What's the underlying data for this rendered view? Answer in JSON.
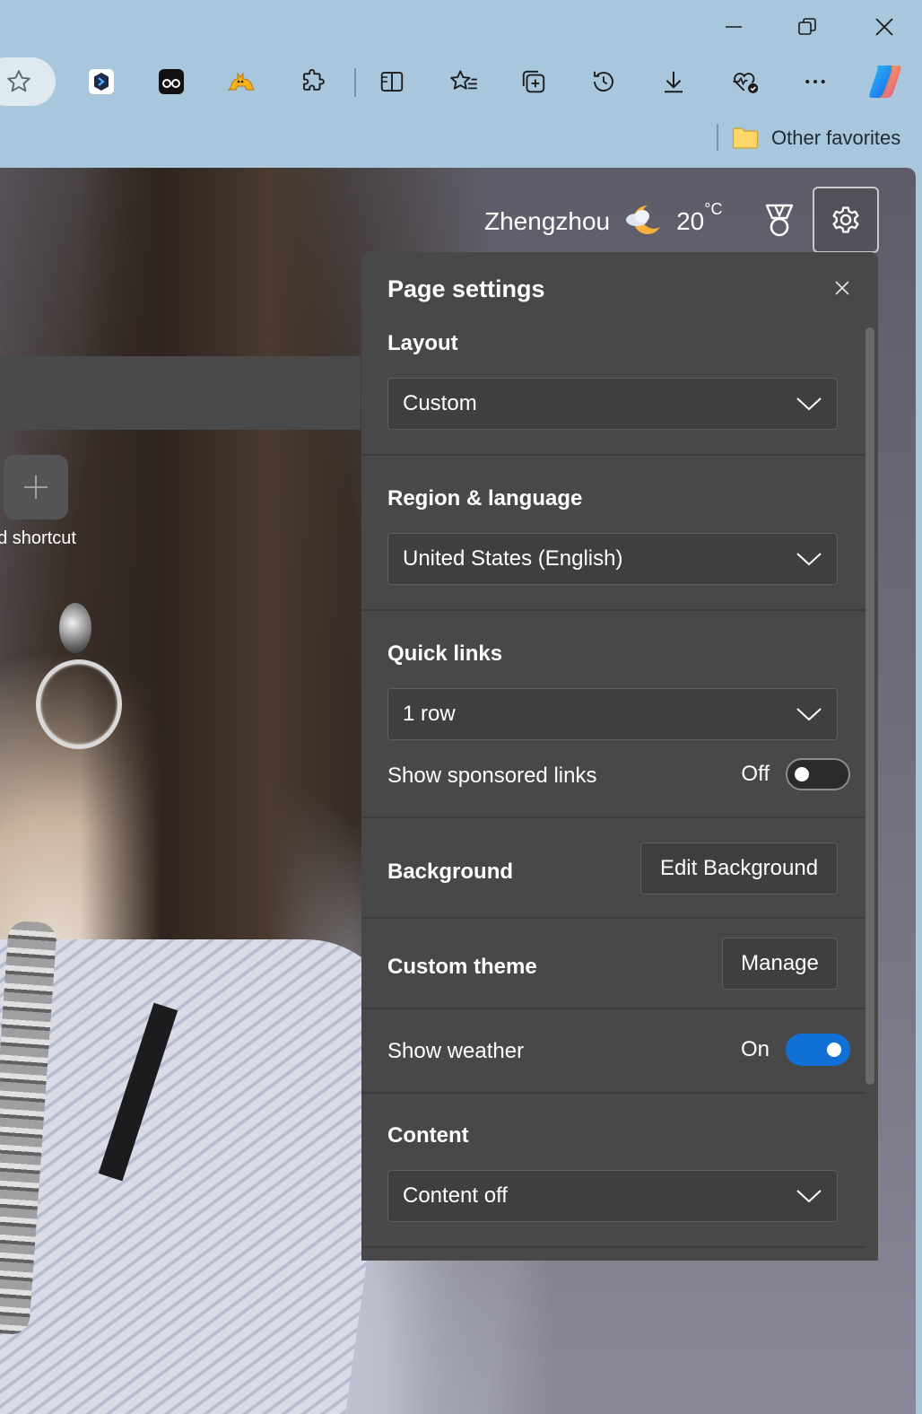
{
  "window": {
    "minimize_icon": "minimize-icon",
    "restore_icon": "restore-icon",
    "close_icon": "close-icon"
  },
  "toolbar": {
    "items": [
      {
        "name": "favorite-star-icon"
      },
      {
        "name": "extension-codeium-icon"
      },
      {
        "name": "extension-glasses-icon"
      },
      {
        "name": "extension-cat-icon"
      },
      {
        "name": "extensions-puzzle-icon"
      },
      {
        "name": "split-screen-icon"
      },
      {
        "name": "favorites-icon"
      },
      {
        "name": "collections-icon"
      },
      {
        "name": "history-icon"
      },
      {
        "name": "downloads-icon"
      },
      {
        "name": "browser-essentials-icon"
      },
      {
        "name": "more-icon"
      },
      {
        "name": "copilot-icon"
      }
    ]
  },
  "favorites_bar": {
    "other_favorites_label": "Other favorites"
  },
  "ntp": {
    "add_shortcut_label": "dd shortcut",
    "weather": {
      "city": "Zhengzhou",
      "temperature": "20",
      "unit": "°C"
    }
  },
  "settings_panel": {
    "title": "Page settings",
    "layout": {
      "label": "Layout",
      "value": "Custom"
    },
    "region": {
      "label": "Region & language",
      "value": "United States (English)"
    },
    "quick_links": {
      "label": "Quick links",
      "value": "1 row",
      "sponsored_label": "Show sponsored links",
      "sponsored_state": "Off"
    },
    "background": {
      "label": "Background",
      "button": "Edit Background"
    },
    "custom_theme": {
      "label": "Custom theme",
      "button": "Manage"
    },
    "weather": {
      "label": "Show weather",
      "state": "On"
    },
    "content": {
      "label": "Content",
      "value": "Content off"
    }
  },
  "colors": {
    "chrome_bg": "#a9c7dc",
    "panel_bg": "#484849",
    "accent": "#1170d6"
  }
}
